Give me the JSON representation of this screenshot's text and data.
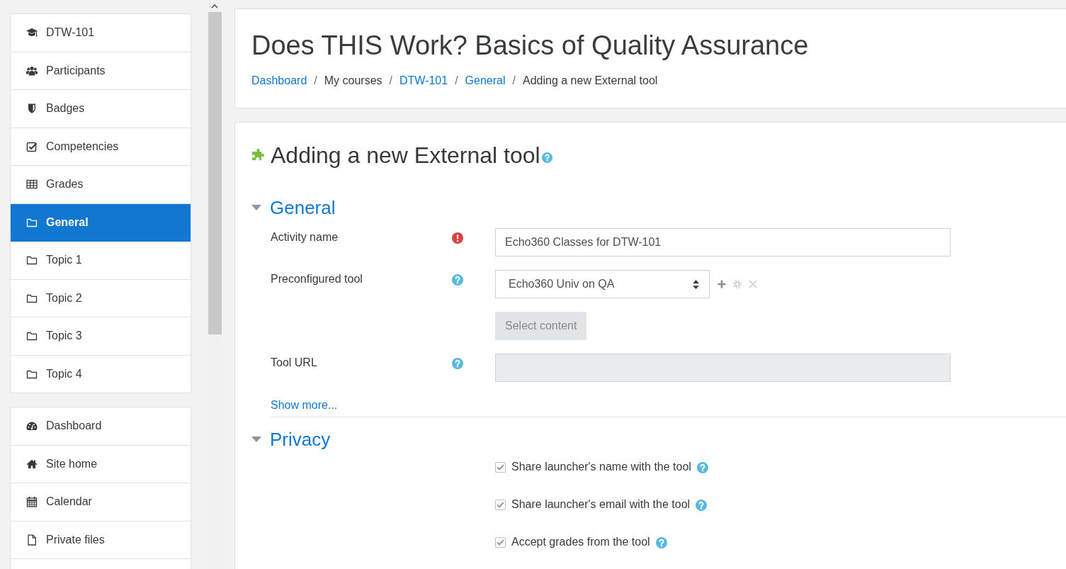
{
  "sidebar": {
    "panels": [
      {
        "items": [
          {
            "kind": "course",
            "label": "DTW-101",
            "selected": false
          },
          {
            "kind": "participants",
            "label": "Participants",
            "selected": false
          },
          {
            "kind": "badges",
            "label": "Badges",
            "selected": false
          },
          {
            "kind": "competencies",
            "label": "Competencies",
            "selected": false
          },
          {
            "kind": "grades",
            "label": "Grades",
            "selected": false
          },
          {
            "kind": "section",
            "label": "General",
            "selected": true
          },
          {
            "kind": "section",
            "label": "Topic 1",
            "selected": false
          },
          {
            "kind": "section",
            "label": "Topic 2",
            "selected": false
          },
          {
            "kind": "section",
            "label": "Topic 3",
            "selected": false
          },
          {
            "kind": "section",
            "label": "Topic 4",
            "selected": false
          }
        ]
      },
      {
        "items": [
          {
            "kind": "dashboard",
            "label": "Dashboard",
            "selected": false
          },
          {
            "kind": "home",
            "label": "Site home",
            "selected": false
          },
          {
            "kind": "calendar",
            "label": "Calendar",
            "selected": false
          },
          {
            "kind": "files",
            "label": "Private files",
            "selected": false
          }
        ]
      }
    ]
  },
  "header": {
    "title": "Does THIS Work? Basics of Quality Assurance",
    "breadcrumb": [
      {
        "kind": "link",
        "label": "Dashboard"
      },
      {
        "kind": "separator",
        "label": "/"
      },
      {
        "kind": "text",
        "label": "My courses"
      },
      {
        "kind": "separator",
        "label": "/"
      },
      {
        "kind": "link",
        "label": "DTW-101"
      },
      {
        "kind": "separator",
        "label": "/"
      },
      {
        "kind": "link",
        "label": "General"
      },
      {
        "kind": "separator",
        "label": "/"
      },
      {
        "kind": "text",
        "label": "Adding a new External tool"
      }
    ]
  },
  "form": {
    "heading": "Adding a new External tool",
    "help": true,
    "sections": [
      {
        "title": "General",
        "expanded": true,
        "fields": [
          {
            "kind": "text",
            "label": "Activity name",
            "required": true,
            "help": false,
            "value": "Echo360 Classes for DTW-101",
            "disabled": false
          },
          {
            "kind": "select",
            "label": "Preconfigured tool",
            "required": false,
            "help": true,
            "value": "Echo360 Univ on QA",
            "disabled": false,
            "actions": [
              {
                "kind": "add",
                "disabled": false
              },
              {
                "kind": "configure",
                "disabled": true
              },
              {
                "kind": "delete",
                "disabled": true
              }
            ]
          },
          {
            "kind": "button",
            "label": "Select content",
            "disabled": true
          },
          {
            "kind": "text",
            "label": "Tool URL",
            "required": false,
            "help": true,
            "disabled": true
          }
        ],
        "show_more": "Show more..."
      },
      {
        "title": "Privacy",
        "expanded": true,
        "fields": [
          {
            "kind": "checkbox",
            "label": "Share launcher's name with the tool",
            "checked": true,
            "disabled": true,
            "help": true
          },
          {
            "kind": "checkbox",
            "label": "Share launcher's email with the tool",
            "checked": true,
            "disabled": true,
            "help": true
          },
          {
            "kind": "checkbox",
            "label": "Accept grades from the tool",
            "checked": true,
            "disabled": true,
            "help": true
          }
        ]
      }
    ]
  }
}
